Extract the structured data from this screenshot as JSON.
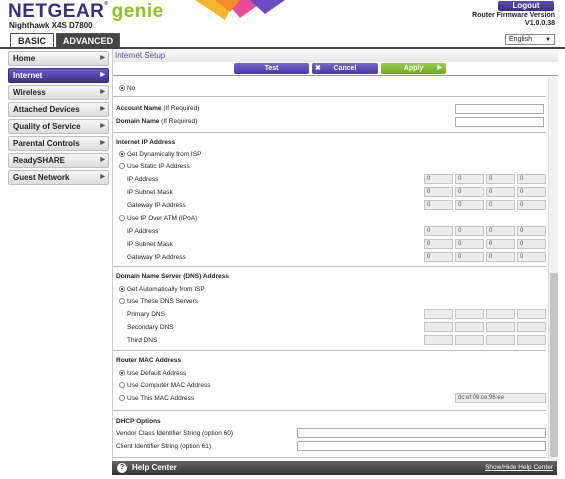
{
  "header": {
    "brand": "NETGEAR",
    "genie": "genie",
    "tm": "®",
    "model": "Nighthawk X4S D7800",
    "logout_label": "Logout",
    "firmware_label": "Router Firmware Version",
    "firmware_version": "V1.0.0.38",
    "language": "English"
  },
  "tabs": {
    "basic": "BASIC",
    "advanced": "ADVANCED"
  },
  "sidebar": {
    "items": [
      {
        "label": "Home"
      },
      {
        "label": "Internet"
      },
      {
        "label": "Wireless"
      },
      {
        "label": "Attached Devices"
      },
      {
        "label": "Quality of Service"
      },
      {
        "label": "Parental Controls"
      },
      {
        "label": "ReadySHARE"
      },
      {
        "label": "Guest Network"
      }
    ]
  },
  "page": {
    "title": "Internet Setup",
    "test_label": "Test",
    "cancel_label": "Cancel",
    "apply_label": "Apply"
  },
  "form": {
    "no_label": "No",
    "account_name_label": "Account Name",
    "account_name_hint": "(If Required)",
    "domain_name_label": "Domain Name",
    "domain_name_hint": "(If Required)",
    "ip_section": "Internet IP Address",
    "ip_dynamic": "Get Dynamically from ISP",
    "ip_static": "Use Static IP Address",
    "ip_address": "IP Address",
    "ip_subnet": "IP Subnet Mask",
    "gateway": "Gateway IP Address",
    "ipoa": "Use IP Over ATM (IPoA)",
    "ipoa_ip": "IP Address",
    "ipoa_subnet": "IP Subnet Mask",
    "ipoa_gateway": "Gateway IP Address",
    "zero": "0",
    "dns_section": "Domain Name Server (DNS) Address",
    "dns_auto": "Get Automatically from ISP",
    "dns_manual": "Use These DNS Servers",
    "dns_primary": "Primary DNS",
    "dns_secondary": "Secondary DNS",
    "dns_third": "Third DNS",
    "mac_section": "Router MAC Address",
    "mac_default": "Use Default Address",
    "mac_computer": "Use Computer MAC Address",
    "mac_this": "Use This MAC Address",
    "mac_value": "dc:ef:09:ce:96:ee",
    "dhcp_section": "DHCP Options",
    "vendor_class": "Vendor Class Identifier String (option 60)",
    "client_id": "Client Identifier String (option 61)"
  },
  "footer": {
    "help_icon": "?",
    "help_label": "Help Center",
    "toggle_label": "Show/Hide Help Center"
  },
  "colors": {
    "brand": "#3a2e8c",
    "genie": "#8dc21f",
    "apply": "#8dc21f"
  }
}
